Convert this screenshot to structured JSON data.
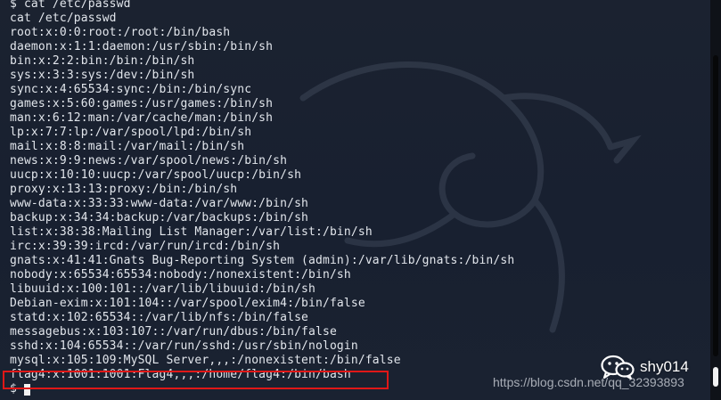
{
  "terminal": {
    "command_line": "$ cat /etc/passwd",
    "echo_line": "cat /etc/passwd",
    "output_lines": [
      "root:x:0:0:root:/root:/bin/bash",
      "daemon:x:1:1:daemon:/usr/sbin:/bin/sh",
      "bin:x:2:2:bin:/bin:/bin/sh",
      "sys:x:3:3:sys:/dev:/bin/sh",
      "sync:x:4:65534:sync:/bin:/bin/sync",
      "games:x:5:60:games:/usr/games:/bin/sh",
      "man:x:6:12:man:/var/cache/man:/bin/sh",
      "lp:x:7:7:lp:/var/spool/lpd:/bin/sh",
      "mail:x:8:8:mail:/var/mail:/bin/sh",
      "news:x:9:9:news:/var/spool/news:/bin/sh",
      "uucp:x:10:10:uucp:/var/spool/uucp:/bin/sh",
      "proxy:x:13:13:proxy:/bin:/bin/sh",
      "www-data:x:33:33:www-data:/var/www:/bin/sh",
      "backup:x:34:34:backup:/var/backups:/bin/sh",
      "list:x:38:38:Mailing List Manager:/var/list:/bin/sh",
      "irc:x:39:39:ircd:/var/run/ircd:/bin/sh",
      "gnats:x:41:41:Gnats Bug-Reporting System (admin):/var/lib/gnats:/bin/sh",
      "nobody:x:65534:65534:nobody:/nonexistent:/bin/sh",
      "libuuid:x:100:101::/var/lib/libuuid:/bin/sh",
      "Debian-exim:x:101:104::/var/spool/exim4:/bin/false",
      "statd:x:102:65534::/var/lib/nfs:/bin/false",
      "messagebus:x:103:107::/var/run/dbus:/bin/false",
      "sshd:x:104:65534::/var/run/sshd:/usr/sbin/nologin",
      "mysql:x:105:109:MySQL Server,,,:/nonexistent:/bin/false"
    ],
    "highlighted_line": "flag4:x:1001:1001:Flag4,,,:/home/flag4:/bin/bash",
    "prompt": "$",
    "highlight_color": "#e01717"
  },
  "watermark": {
    "brand_name": "shy014",
    "url": "https://blog.csdn.net/qq_32393893",
    "icon": "wechat-icon"
  }
}
